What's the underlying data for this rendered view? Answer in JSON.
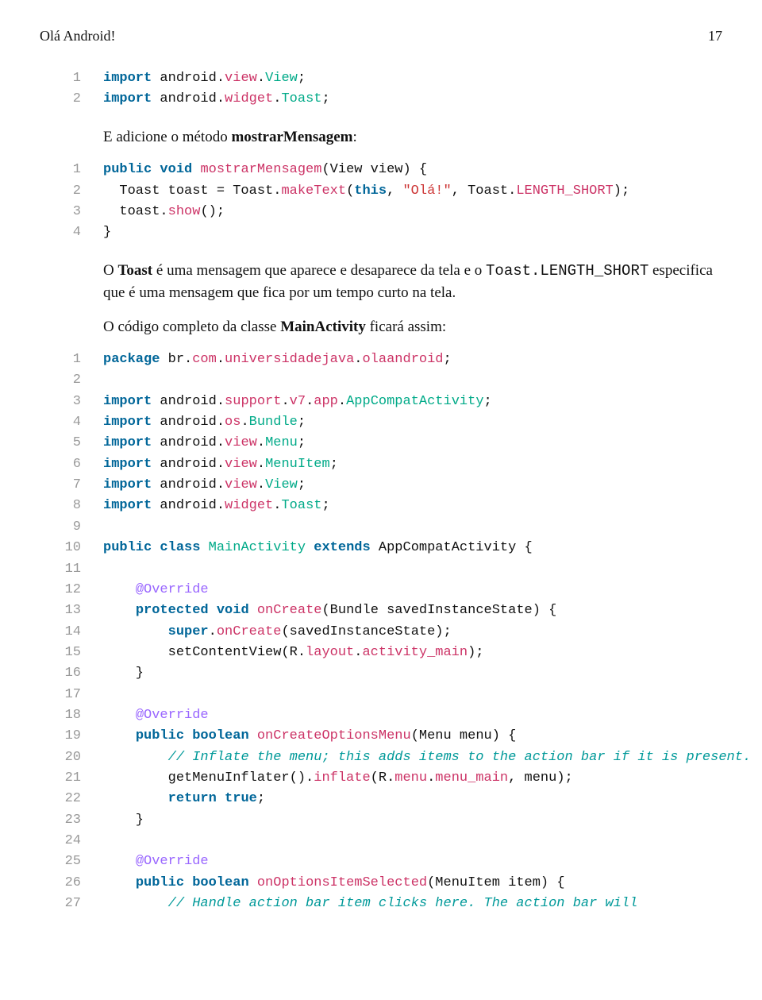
{
  "header": {
    "title": "Olá Android!",
    "pageno": "17"
  },
  "block1": {
    "lines": [
      {
        "n": "1",
        "seg": [
          {
            "c": "kw",
            "t": "import"
          },
          {
            "t": " android"
          },
          {
            "t": "."
          },
          {
            "c": "method",
            "t": "view"
          },
          {
            "t": "."
          },
          {
            "c": "cls",
            "t": "View"
          },
          {
            "t": ";"
          }
        ]
      },
      {
        "n": "2",
        "seg": [
          {
            "c": "kw",
            "t": "import"
          },
          {
            "t": " android"
          },
          {
            "t": "."
          },
          {
            "c": "method",
            "t": "widget"
          },
          {
            "t": "."
          },
          {
            "c": "cls",
            "t": "Toast"
          },
          {
            "t": ";"
          }
        ]
      }
    ]
  },
  "prose1_before": "E adicione o método ",
  "prose1_strong": "mostrarMensagem",
  "prose1_after": ":",
  "block2": {
    "lines": [
      {
        "n": "1",
        "seg": [
          {
            "c": "kw",
            "t": "public"
          },
          {
            "t": " "
          },
          {
            "c": "type",
            "t": "void"
          },
          {
            "t": " "
          },
          {
            "c": "method",
            "t": "mostrarMensagem"
          },
          {
            "t": "(View view) {"
          }
        ]
      },
      {
        "n": "2",
        "seg": [
          {
            "t": "  Toast toast = Toast."
          },
          {
            "c": "method",
            "t": "makeText"
          },
          {
            "t": "("
          },
          {
            "c": "kw",
            "t": "this"
          },
          {
            "t": ", "
          },
          {
            "c": "str",
            "t": "\"Olá!\""
          },
          {
            "t": ", Toast."
          },
          {
            "c": "method",
            "t": "LENGTH_SHORT"
          },
          {
            "t": ");"
          }
        ]
      },
      {
        "n": "3",
        "seg": [
          {
            "t": "  toast."
          },
          {
            "c": "method",
            "t": "show"
          },
          {
            "t": "();"
          }
        ]
      },
      {
        "n": "4",
        "seg": [
          {
            "t": "}"
          }
        ]
      }
    ]
  },
  "prose2a": "O ",
  "prose2b": "Toast",
  "prose2c": " é uma mensagem que aparece e desaparece da tela e o ",
  "prose2d": "Toast.LENGTH_SHORT",
  "prose2e": " especifica que é uma mensagem que fica por um tempo curto na tela.",
  "prose3a": "O código completo da classe ",
  "prose3b": "MainActivity",
  "prose3c": " ficará assim:",
  "block3": {
    "lines": [
      {
        "n": "1",
        "seg": [
          {
            "c": "kw",
            "t": "package"
          },
          {
            "t": " br"
          },
          {
            "t": "."
          },
          {
            "c": "method",
            "t": "com"
          },
          {
            "t": "."
          },
          {
            "c": "method",
            "t": "universidadejava"
          },
          {
            "t": "."
          },
          {
            "c": "method",
            "t": "olaandroid"
          },
          {
            "t": ";"
          }
        ]
      },
      {
        "n": "2",
        "seg": []
      },
      {
        "n": "3",
        "seg": [
          {
            "c": "kw",
            "t": "import"
          },
          {
            "t": " android"
          },
          {
            "t": "."
          },
          {
            "c": "method",
            "t": "support"
          },
          {
            "t": "."
          },
          {
            "c": "method",
            "t": "v7"
          },
          {
            "t": "."
          },
          {
            "c": "method",
            "t": "app"
          },
          {
            "t": "."
          },
          {
            "c": "cls",
            "t": "AppCompatActivity"
          },
          {
            "t": ";"
          }
        ]
      },
      {
        "n": "4",
        "seg": [
          {
            "c": "kw",
            "t": "import"
          },
          {
            "t": " android"
          },
          {
            "t": "."
          },
          {
            "c": "method",
            "t": "os"
          },
          {
            "t": "."
          },
          {
            "c": "cls",
            "t": "Bundle"
          },
          {
            "t": ";"
          }
        ]
      },
      {
        "n": "5",
        "seg": [
          {
            "c": "kw",
            "t": "import"
          },
          {
            "t": " android"
          },
          {
            "t": "."
          },
          {
            "c": "method",
            "t": "view"
          },
          {
            "t": "."
          },
          {
            "c": "cls",
            "t": "Menu"
          },
          {
            "t": ";"
          }
        ]
      },
      {
        "n": "6",
        "seg": [
          {
            "c": "kw",
            "t": "import"
          },
          {
            "t": " android"
          },
          {
            "t": "."
          },
          {
            "c": "method",
            "t": "view"
          },
          {
            "t": "."
          },
          {
            "c": "cls",
            "t": "MenuItem"
          },
          {
            "t": ";"
          }
        ]
      },
      {
        "n": "7",
        "seg": [
          {
            "c": "kw",
            "t": "import"
          },
          {
            "t": " android"
          },
          {
            "t": "."
          },
          {
            "c": "method",
            "t": "view"
          },
          {
            "t": "."
          },
          {
            "c": "cls",
            "t": "View"
          },
          {
            "t": ";"
          }
        ]
      },
      {
        "n": "8",
        "seg": [
          {
            "c": "kw",
            "t": "import"
          },
          {
            "t": " android"
          },
          {
            "t": "."
          },
          {
            "c": "method",
            "t": "widget"
          },
          {
            "t": "."
          },
          {
            "c": "cls",
            "t": "Toast"
          },
          {
            "t": ";"
          }
        ]
      },
      {
        "n": "9",
        "seg": []
      },
      {
        "n": "10",
        "seg": [
          {
            "c": "kw",
            "t": "public"
          },
          {
            "t": " "
          },
          {
            "c": "kw",
            "t": "class"
          },
          {
            "t": " "
          },
          {
            "c": "cls",
            "t": "MainActivity"
          },
          {
            "t": " "
          },
          {
            "c": "kw",
            "t": "extends"
          },
          {
            "t": " AppCompatActivity {"
          }
        ]
      },
      {
        "n": "11",
        "seg": []
      },
      {
        "n": "12",
        "seg": [
          {
            "t": "    "
          },
          {
            "c": "ann",
            "t": "@Override"
          }
        ]
      },
      {
        "n": "13",
        "seg": [
          {
            "t": "    "
          },
          {
            "c": "kw",
            "t": "protected"
          },
          {
            "t": " "
          },
          {
            "c": "type",
            "t": "void"
          },
          {
            "t": " "
          },
          {
            "c": "method",
            "t": "onCreate"
          },
          {
            "t": "(Bundle savedInstanceState) {"
          }
        ]
      },
      {
        "n": "14",
        "seg": [
          {
            "t": "        "
          },
          {
            "c": "kw",
            "t": "super"
          },
          {
            "t": "."
          },
          {
            "c": "method",
            "t": "onCreate"
          },
          {
            "t": "(savedInstanceState);"
          }
        ]
      },
      {
        "n": "15",
        "seg": [
          {
            "t": "        setContentView(R."
          },
          {
            "c": "method",
            "t": "layout"
          },
          {
            "t": "."
          },
          {
            "c": "method",
            "t": "activity_main"
          },
          {
            "t": ");"
          }
        ]
      },
      {
        "n": "16",
        "seg": [
          {
            "t": "    }"
          }
        ]
      },
      {
        "n": "17",
        "seg": []
      },
      {
        "n": "18",
        "seg": [
          {
            "t": "    "
          },
          {
            "c": "ann",
            "t": "@Override"
          }
        ]
      },
      {
        "n": "19",
        "seg": [
          {
            "t": "    "
          },
          {
            "c": "kw",
            "t": "public"
          },
          {
            "t": " "
          },
          {
            "c": "type",
            "t": "boolean"
          },
          {
            "t": " "
          },
          {
            "c": "method",
            "t": "onCreateOptionsMenu"
          },
          {
            "t": "(Menu menu) {"
          }
        ]
      },
      {
        "n": "20",
        "seg": [
          {
            "t": "        "
          },
          {
            "c": "cmt",
            "t": "// Inflate the menu; this adds items to the action bar if it is present."
          }
        ]
      },
      {
        "n": "21",
        "seg": [
          {
            "t": "        getMenuInflater()."
          },
          {
            "c": "method",
            "t": "inflate"
          },
          {
            "t": "(R."
          },
          {
            "c": "method",
            "t": "menu"
          },
          {
            "t": "."
          },
          {
            "c": "method",
            "t": "menu_main"
          },
          {
            "t": ", menu);"
          }
        ]
      },
      {
        "n": "22",
        "seg": [
          {
            "t": "        "
          },
          {
            "c": "kw",
            "t": "return"
          },
          {
            "t": " "
          },
          {
            "c": "kw",
            "t": "true"
          },
          {
            "t": ";"
          }
        ]
      },
      {
        "n": "23",
        "seg": [
          {
            "t": "    }"
          }
        ]
      },
      {
        "n": "24",
        "seg": []
      },
      {
        "n": "25",
        "seg": [
          {
            "t": "    "
          },
          {
            "c": "ann",
            "t": "@Override"
          }
        ]
      },
      {
        "n": "26",
        "seg": [
          {
            "t": "    "
          },
          {
            "c": "kw",
            "t": "public"
          },
          {
            "t": " "
          },
          {
            "c": "type",
            "t": "boolean"
          },
          {
            "t": " "
          },
          {
            "c": "method",
            "t": "onOptionsItemSelected"
          },
          {
            "t": "(MenuItem item) {"
          }
        ]
      },
      {
        "n": "27",
        "seg": [
          {
            "t": "        "
          },
          {
            "c": "cmt",
            "t": "// Handle action bar item clicks here. The action bar will"
          }
        ]
      }
    ]
  }
}
